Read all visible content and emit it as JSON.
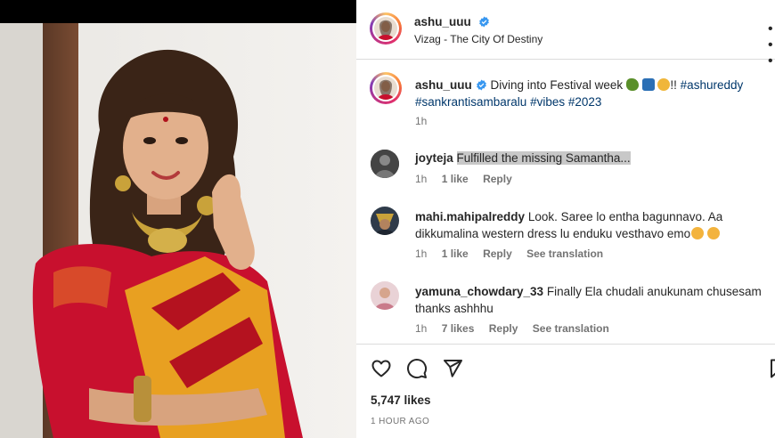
{
  "post": {
    "username": "ashu_uuu",
    "location": "Vizag - The City Of Destiny",
    "caption_text": "Diving into Festival week",
    "caption_emojis": [
      "turtle-emoji",
      "butterfly-emoji",
      "fairy-emoji"
    ],
    "caption_tail": "!!",
    "hashtags": [
      "#ashureddy",
      "#sankrantisambaralu",
      "#vibes",
      "#2023"
    ],
    "caption_time": "1h",
    "likes_label": "5,747 likes",
    "time_ago": "1 HOUR AGO"
  },
  "comments": [
    {
      "username": "joyteja",
      "text": "Fulfilled the missing Samantha...",
      "time": "1h",
      "likes": "1 like",
      "reply": "Reply",
      "translate": ""
    },
    {
      "username": "mahi.mahipalreddy",
      "text": "Look. Saree lo entha bagunnavo. Aa dikkumalina western dress lu enduku vesthavo emo",
      "emojis": [
        "star-struck-emoji",
        "star-struck-emoji"
      ],
      "time": "1h",
      "likes": "1 like",
      "reply": "Reply",
      "translate": "See translation"
    },
    {
      "username": "yamuna_chowdary_33",
      "text": "Finally Ela chudali anukunam chusesam thanks ashhhu",
      "time": "1h",
      "likes": "7 likes",
      "reply": "Reply",
      "translate": "See translation"
    }
  ],
  "icons": [
    "heart-icon",
    "comment-icon",
    "share-icon",
    "bookmark-icon",
    "more-icon",
    "verified-badge-icon"
  ],
  "colors": {
    "verified": "#3897f0",
    "hashtag": "#00376b",
    "meta": "#737373",
    "saree_red": "#c8102e",
    "saree_gold": "#e8a021"
  }
}
